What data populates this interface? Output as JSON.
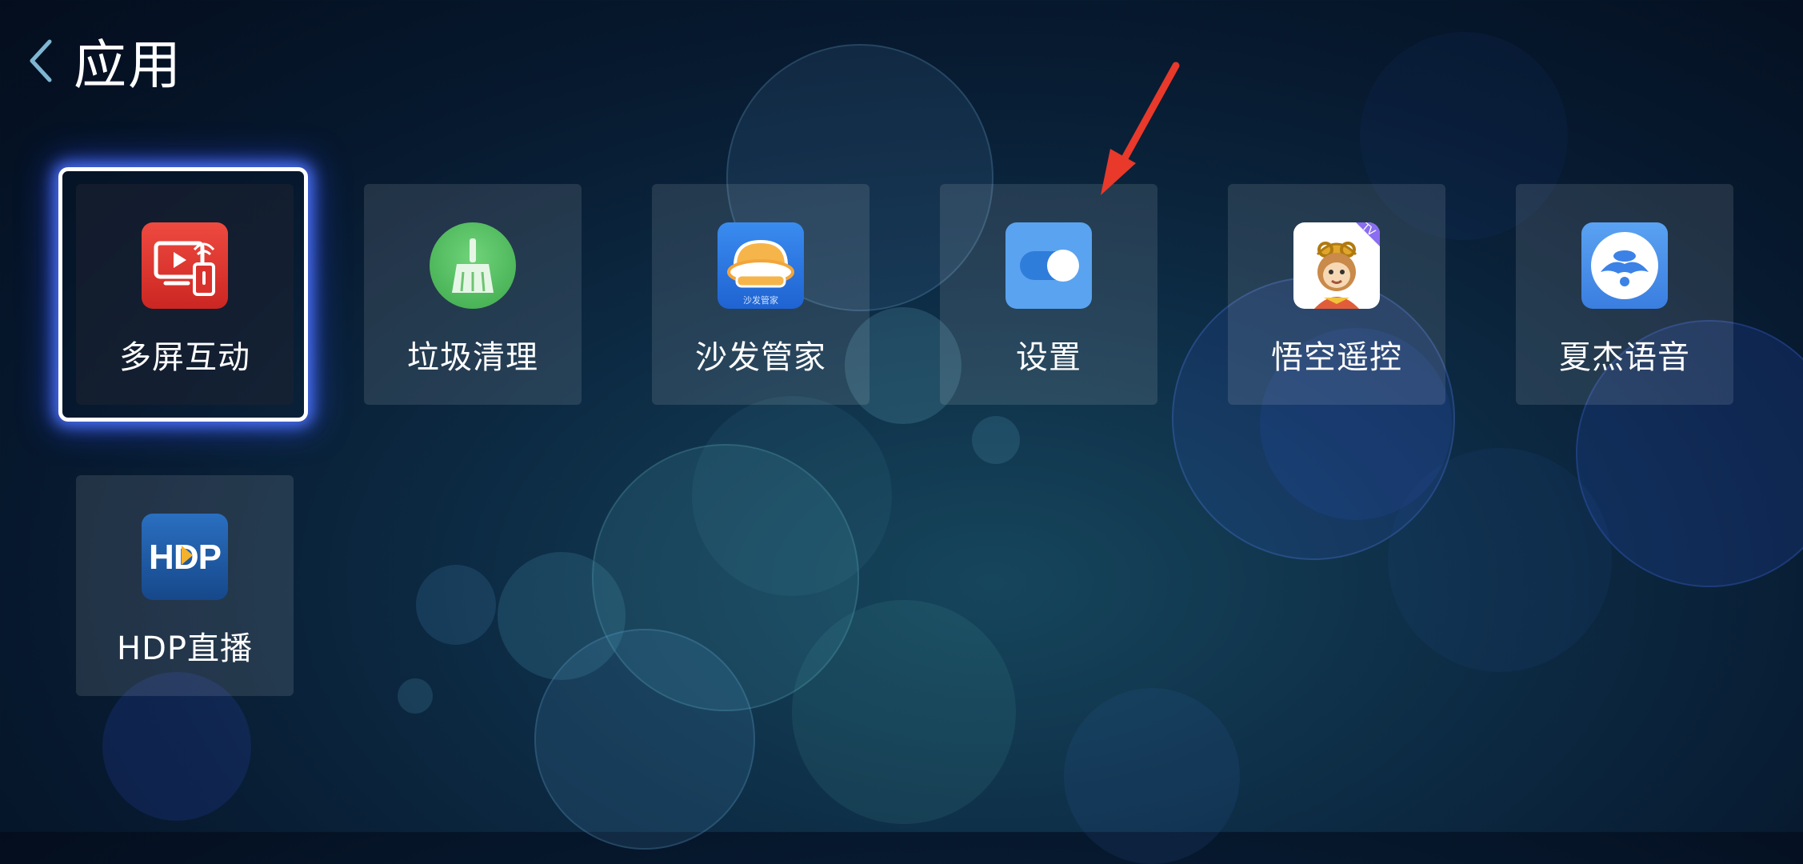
{
  "header": {
    "back_icon": "chevron-left-icon",
    "title": "应用"
  },
  "apps": [
    {
      "label": "多屏互动",
      "icon": "screen-cast-icon",
      "color": "#e0302e",
      "focused": true
    },
    {
      "label": "垃圾清理",
      "icon": "broom-icon",
      "color": "#4cbb58"
    },
    {
      "label": "沙发管家",
      "icon": "sofa-icon",
      "color": "#2a78e4",
      "icon_caption": "沙发管家"
    },
    {
      "label": "设置",
      "icon": "toggle-switch-icon",
      "color": "#5aa3f0"
    },
    {
      "label": "悟空遥控",
      "icon": "monkey-king-icon",
      "color": "#ffffff",
      "icon_badge": "TV"
    },
    {
      "label": "夏杰语音",
      "icon": "voice-assistant-icon",
      "color": "#4a8ee8"
    },
    {
      "label": "HDP直播",
      "icon": "hdp-logo-icon",
      "color": "#1f5ca8",
      "icon_text": "HDP"
    }
  ],
  "annotation": {
    "icon": "red-arrow-icon",
    "color": "#e8392b"
  }
}
